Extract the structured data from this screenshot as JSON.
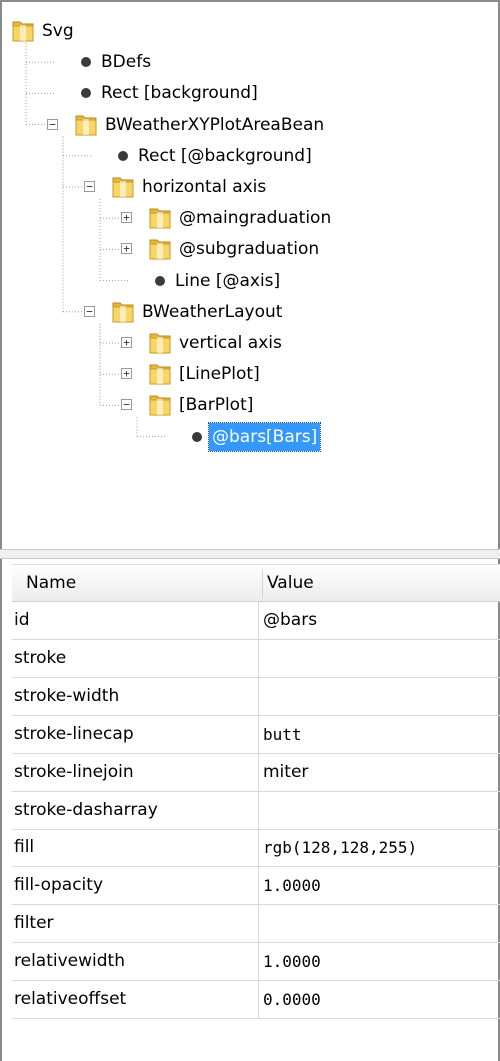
{
  "tree": {
    "nodes": [
      {
        "label": "Svg",
        "type": "folder",
        "expanded": true
      },
      {
        "label": "BDefs",
        "type": "leaf"
      },
      {
        "label": "Rect [background]",
        "type": "leaf"
      },
      {
        "label": "BWeatherXYPlotAreaBean",
        "type": "folder",
        "expanded": true
      },
      {
        "label": "Rect [@background]",
        "type": "leaf"
      },
      {
        "label": "horizontal axis",
        "type": "folder",
        "expanded": true
      },
      {
        "label": "@maingraduation",
        "type": "folder",
        "expanded": false
      },
      {
        "label": "@subgraduation",
        "type": "folder",
        "expanded": false
      },
      {
        "label": "Line [@axis]",
        "type": "leaf"
      },
      {
        "label": "BWeatherLayout",
        "type": "folder",
        "expanded": true
      },
      {
        "label": "vertical axis",
        "type": "folder",
        "expanded": false
      },
      {
        "label": "[LinePlot]",
        "type": "folder",
        "expanded": false
      },
      {
        "label": "[BarPlot]",
        "type": "folder",
        "expanded": true
      },
      {
        "label": "@bars[Bars]",
        "type": "leaf",
        "selected": true
      }
    ]
  },
  "properties": {
    "columns": {
      "name": "Name",
      "value": "Value"
    },
    "rows": [
      {
        "name": "id",
        "value": "@bars"
      },
      {
        "name": "stroke",
        "value": ""
      },
      {
        "name": "stroke-width",
        "value": ""
      },
      {
        "name": "stroke-linecap",
        "value": "butt"
      },
      {
        "name": "stroke-linejoin",
        "value": "miter"
      },
      {
        "name": "stroke-dasharray",
        "value": ""
      },
      {
        "name": "fill",
        "value": "rgb(128,128,255)"
      },
      {
        "name": "fill-opacity",
        "value": "1.0000"
      },
      {
        "name": "filter",
        "value": ""
      },
      {
        "name": "relativewidth",
        "value": "1.0000"
      },
      {
        "name": "relativeoffset",
        "value": "0.0000"
      }
    ]
  },
  "colors": {
    "selection": "#3399ff",
    "folder": "#f2c94c"
  }
}
